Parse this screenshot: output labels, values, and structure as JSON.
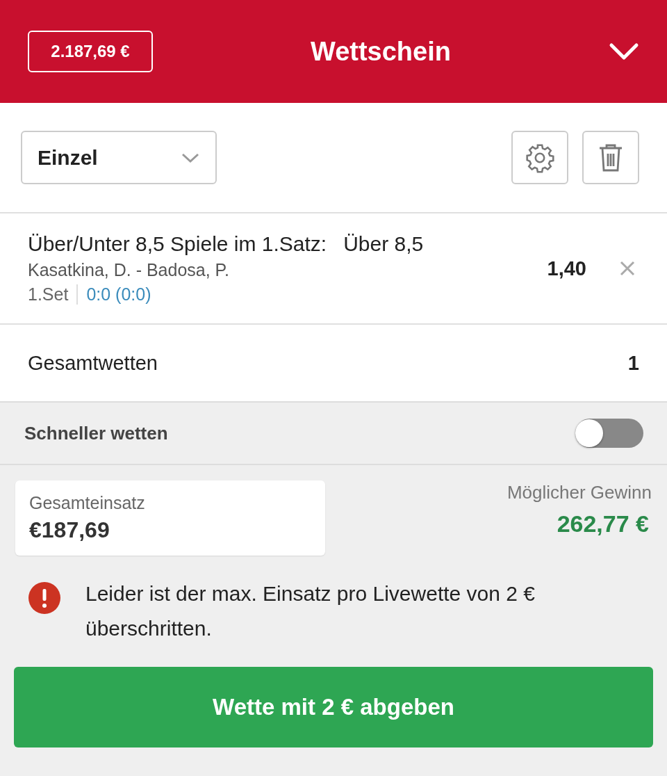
{
  "header": {
    "balance": "2.187,69 €",
    "title": "Wettschein"
  },
  "toolbar": {
    "bet_type": "Einzel"
  },
  "selection": {
    "market": "Über/Unter 8,5 Spiele im 1.Satz:",
    "pick": "Über 8,5",
    "event": "Kasatkina, D. - Badosa, P.",
    "period": "1.Set",
    "score": "0:0 (0:0)",
    "odds": "1,40"
  },
  "total_bets": {
    "label": "Gesamtwetten",
    "value": "1"
  },
  "quick_bet": {
    "label": "Schneller wetten",
    "on": false
  },
  "stake": {
    "label": "Gesamteinsatz",
    "value": "€187,69"
  },
  "winnings": {
    "label": "Möglicher Gewinn",
    "value": "262,77 €"
  },
  "warning": "Leider ist der max. Einsatz pro Livewette von 2 € überschritten.",
  "submit": "Wette mit 2 € abgeben"
}
